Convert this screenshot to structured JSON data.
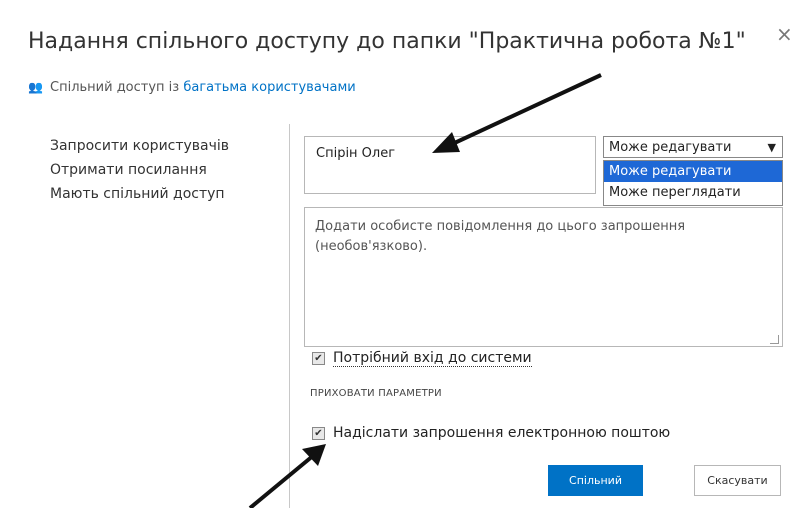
{
  "dialog": {
    "title": "Надання спільного доступу до папки \"Практична робота №1\"",
    "close_glyph": "×",
    "subtitle_prefix": "Спільний доступ із ",
    "subtitle_link": "багатьма користувачами"
  },
  "nav": {
    "items": [
      {
        "label": "Запросити користувачів"
      },
      {
        "label": "Отримати посилання"
      },
      {
        "label": "Мають спільний доступ"
      }
    ]
  },
  "form": {
    "recipient_value": "Спірін Олег",
    "permission": {
      "selected": "Може редагувати",
      "options": [
        "Може редагувати",
        "Може переглядати"
      ],
      "highlighted_index": 0
    },
    "message_placeholder": "Додати особисте повідомлення до цього запрошення (необов'язково).",
    "require_signin_label": "Потрібний вхід до системи",
    "require_signin_checked": true,
    "hide_options_label": "ПРИХОВАТИ ПАРАМЕТРИ",
    "send_email_label": "Надіслати запрошення електронною поштою",
    "send_email_checked": true
  },
  "buttons": {
    "share_label": "Спільний доступ",
    "cancel_label": "Скасувати"
  },
  "icons": {
    "people": "people-icon",
    "close": "close-icon",
    "caret": "chevron-down-icon",
    "check": "check-icon"
  },
  "colors": {
    "accent": "#0072c6",
    "selected_option": "#1e68d6"
  }
}
